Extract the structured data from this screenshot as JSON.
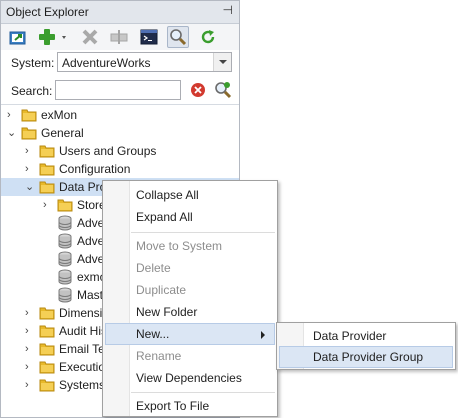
{
  "panel": {
    "title": "Object Explorer",
    "pin_glyph": "⊣"
  },
  "toolbar": {
    "buttons": [
      {
        "name": "open-icon"
      },
      {
        "name": "add-icon"
      },
      {
        "name": "add-dropdown-icon"
      },
      {
        "name": "delete-icon"
      },
      {
        "name": "move-icon"
      },
      {
        "name": "console-icon"
      },
      {
        "name": "search-icon",
        "pressed": true
      },
      {
        "name": "refresh-icon"
      }
    ]
  },
  "system": {
    "label": "System:",
    "value": "AdventureWorks"
  },
  "search": {
    "label": "Search:",
    "value": ""
  },
  "tree": {
    "items": [
      {
        "label": "exMon",
        "expander": "›",
        "icon": "folder"
      },
      {
        "label": "General",
        "expander": "⌄",
        "icon": "folder"
      },
      {
        "label": "Users and Groups",
        "expander": "›",
        "icon": "folder"
      },
      {
        "label": "Configuration",
        "expander": "›",
        "icon": "folder"
      },
      {
        "label": "Data Prov",
        "expander": "⌄",
        "icon": "folder"
      },
      {
        "label": "Store",
        "expander": "›",
        "icon": "folder"
      },
      {
        "label": "Adve",
        "expander": "",
        "icon": "database"
      },
      {
        "label": "Adve",
        "expander": "",
        "icon": "database"
      },
      {
        "label": "Adve",
        "expander": "",
        "icon": "database"
      },
      {
        "label": "exmo",
        "expander": "",
        "icon": "database"
      },
      {
        "label": "Mast",
        "expander": "",
        "icon": "database"
      },
      {
        "label": "Dimensio",
        "expander": "›",
        "icon": "folder"
      },
      {
        "label": "Audit His",
        "expander": "›",
        "icon": "folder"
      },
      {
        "label": "Email Ter",
        "expander": "›",
        "icon": "folder"
      },
      {
        "label": "Executio",
        "expander": "›",
        "icon": "folder"
      },
      {
        "label": "Systems",
        "expander": "›",
        "icon": "folder"
      }
    ]
  },
  "context_menu": {
    "items": [
      {
        "label": "Collapse All",
        "enabled": true
      },
      {
        "label": "Expand All",
        "enabled": true
      },
      {
        "label": "Move to System",
        "enabled": false
      },
      {
        "label": "Delete",
        "enabled": false
      },
      {
        "label": "Duplicate",
        "enabled": false
      },
      {
        "label": "New Folder",
        "enabled": true
      },
      {
        "label": "New...",
        "enabled": true,
        "submenu": true
      },
      {
        "label": "Rename",
        "enabled": false
      },
      {
        "label": "View Dependencies",
        "enabled": true
      },
      {
        "label": "Export To File",
        "enabled": true
      }
    ]
  },
  "submenu": {
    "items": [
      {
        "label": "Data Provider"
      },
      {
        "label": "Data Provider Group"
      }
    ]
  },
  "colors": {
    "folder": "#e8b92a",
    "add_green": "#3a9d2e",
    "clear_red": "#d23a2f",
    "selection": "#cfe0f4"
  }
}
